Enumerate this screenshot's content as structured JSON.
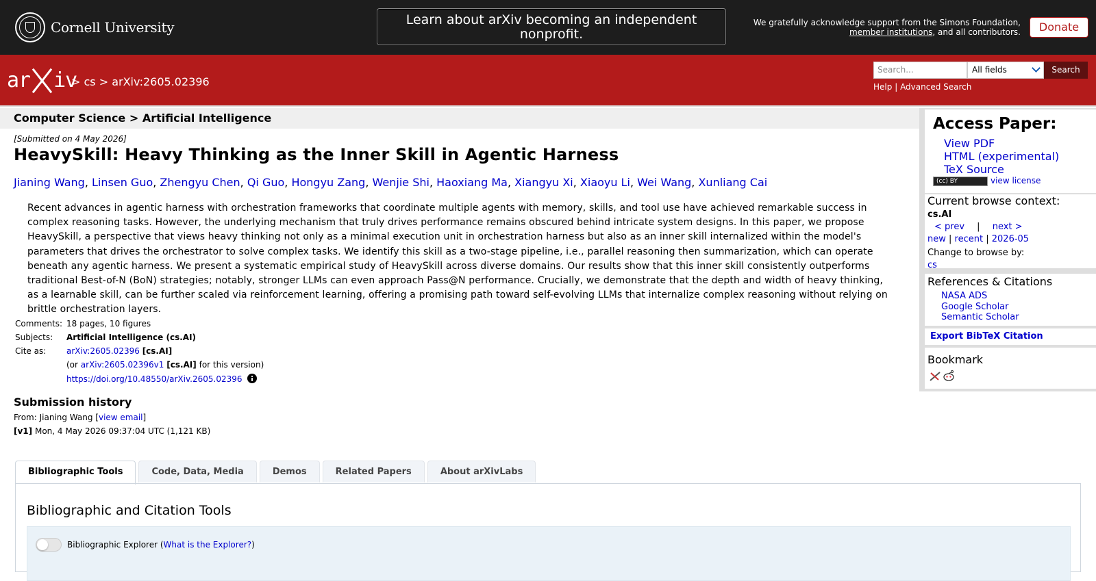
{
  "topbar": {
    "cornell_name": "Cornell University",
    "announcement": "Learn about arXiv becoming an independent nonprofit.",
    "support_line1": "We gratefully acknowledge support from the Simons Foundation,",
    "support_link": "member institutions",
    "support_line2_rest": ", and all contributors.",
    "donate_label": "Donate"
  },
  "header": {
    "logo_left": "ar",
    "logo_right": "iv",
    "breadcrumb": "> cs > arXiv:2605.02396",
    "search_placeholder": "Search...",
    "search_field_selected": "All fields",
    "search_button": "Search",
    "help": "Help",
    "separator": "|",
    "advanced_search": "Advanced Search"
  },
  "subheader": "Computer Science > Artificial Intelligence",
  "paper": {
    "submitted": "[Submitted on 4 May 2026]",
    "title": "HeavySkill: Heavy Thinking as the Inner Skill in Agentic Harness",
    "authors": [
      "Jianing Wang",
      "Linsen Guo",
      "Zhengyu Chen",
      "Qi Guo",
      "Hongyu Zang",
      "Wenjie Shi",
      "Haoxiang Ma",
      "Xiangyu Xi",
      "Xiaoyu Li",
      "Wei Wang",
      "Xunliang Cai"
    ],
    "abstract": "Recent advances in agentic harness with orchestration frameworks that coordinate multiple agents with memory, skills, and tool use have achieved remarkable success in complex reasoning tasks. However, the underlying mechanism that truly drives performance remains obscured behind intricate system designs. In this paper, we propose HeavySkill, a perspective that views heavy thinking not only as a minimal execution unit in orchestration harness but also as an inner skill internalized within the model's parameters that drives the orchestrator to solve complex tasks. We identify this skill as a two-stage pipeline, i.e., parallel reasoning then summarization, which can operate beneath any agentic harness. We present a systematic empirical study of HeavySkill across diverse domains. Our results show that this inner skill consistently outperforms traditional Best-of-N (BoN) strategies; notably, stronger LLMs can even approach Pass@N performance. Crucially, we demonstrate that the depth and width of heavy thinking, as a learnable skill, can be further scaled via reinforcement learning, offering a promising path toward self-evolving LLMs that internalize complex reasoning without relying on brittle orchestration layers.",
    "comments_label": "Comments:",
    "comments": "18 pages, 10 figures",
    "subjects_label": "Subjects:",
    "subjects": "Artificial Intelligence (cs.AI)",
    "cite_label": "Cite as:",
    "cite_id": "arXiv:2605.02396",
    "cite_tag": "[cs.AI]",
    "cite_version_prefix": "(or",
    "cite_version_id": "arXiv:2605.02396v1",
    "cite_version_tag": "[cs.AI]",
    "cite_version_suffix": "for this version)",
    "doi": "https://doi.org/10.48550/arXiv.2605.02396"
  },
  "history": {
    "heading": "Submission history",
    "from_prefix": "From: Jianing Wang [",
    "view_email": "view email",
    "from_suffix": "]",
    "v1_label": "[v1]",
    "v1_text": "Mon, 4 May 2026 09:37:04 UTC (1,121 KB)"
  },
  "tabs": [
    "Bibliographic Tools",
    "Code, Data, Media",
    "Demos",
    "Related Papers",
    "About arXivLabs"
  ],
  "panel": {
    "heading": "Bibliographic and Citation Tools",
    "explorer_label": "Bibliographic Explorer",
    "explorer_paren_open": "(",
    "explorer_link": "What is the Explorer?",
    "explorer_paren_close": ")"
  },
  "sidebar": {
    "access_heading": "Access Paper:",
    "access_links": [
      "View PDF",
      "HTML (experimental)",
      "TeX Source"
    ],
    "license_badge": "(cc) BY",
    "view_license": "view license",
    "context_heading": "Current browse context:",
    "context_value": "cs.AI",
    "prev": "< prev",
    "pipe": "|",
    "next": "next >",
    "new": "new",
    "recent": "recent",
    "date": "2026-05",
    "change_browse": "Change to browse by:",
    "browse_cs": "cs",
    "refs_heading": "References & Citations",
    "refs_links": [
      "NASA ADS",
      "Google Scholar",
      "Semantic Scholar"
    ],
    "export_bibtex": "Export BibTeX Citation",
    "bookmark_heading": "Bookmark"
  },
  "colors": {
    "arxiv_red": "#b31b1b",
    "link_blue": "#0000cc",
    "topbar": "#1d1d1d"
  }
}
